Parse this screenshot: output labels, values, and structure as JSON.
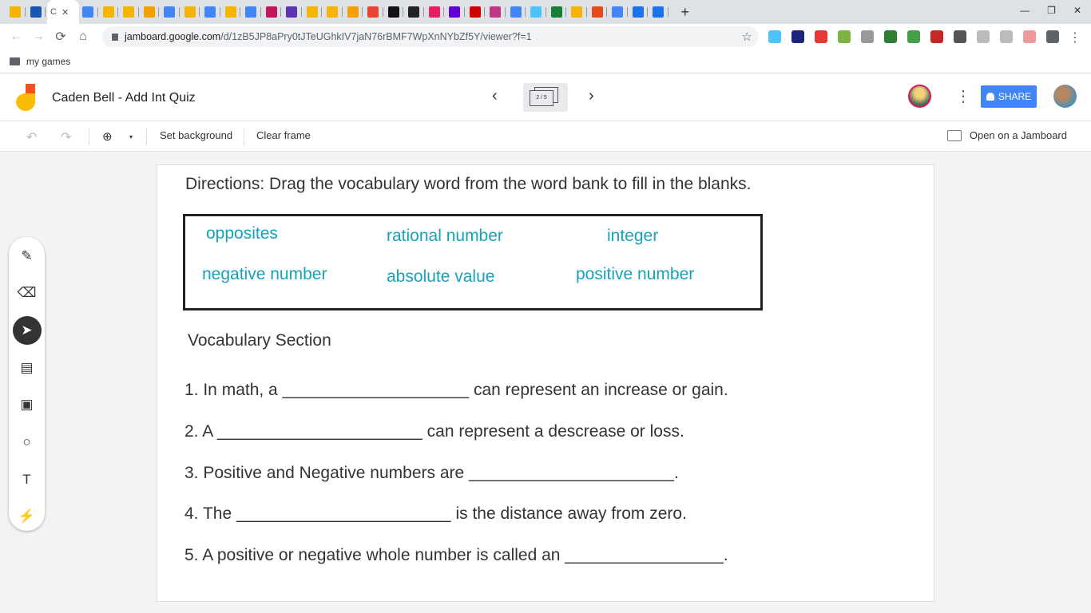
{
  "browser": {
    "active_tab_label": "C",
    "tab_colors": [
      "#f4b400",
      "#1a56b0",
      "#4285f4",
      "#f4b400",
      "#f4b400",
      "#f5a000",
      "#4285f4",
      "#f4b400",
      "#4285f4",
      "#f4b400",
      "#4285f4",
      "#c2185b",
      "#5e35b1",
      "#f4b400",
      "#f4b400",
      "#f5a000",
      "#ea4335",
      "#111111",
      "#222222",
      "#e91e63",
      "#6001d2",
      "#d00000",
      "#c13584",
      "#4285f4",
      "#4fc3f7",
      "#188038",
      "#f4b400",
      "#e64a19",
      "#4285f4",
      "#1a73e8",
      "#1a73e8"
    ],
    "url_host": "jamboard.google.com",
    "url_path": "/d/1zB5JP8aPry0tJTeUGhkIV7jaN76rBMF7WpXnNYbZf5Y/viewer?f=1",
    "extension_colors": [
      "#4fc3f7",
      "#1a237e",
      "#e53935",
      "#7cb342",
      "#999999",
      "#2e7d32",
      "#43a047",
      "#c62828",
      "#555555",
      "#bbbbbb",
      "#bbbbbb",
      "#ef9a9a",
      "#5f6368"
    ],
    "bookmark": "my games"
  },
  "app": {
    "title": "Caden Bell - Add Int Quiz",
    "frame_indicator": "2 / 5",
    "share_label": "SHARE",
    "toolbar": {
      "set_background": "Set background",
      "clear_frame": "Clear frame",
      "open_jamboard": "Open on a Jamboard"
    }
  },
  "frame": {
    "directions": "Directions: Drag the vocabulary word from the word bank to fill in the blanks.",
    "word_bank": [
      "opposites",
      "rational number",
      "integer",
      "negative number",
      "absolute value",
      "positive number"
    ],
    "section_title": "Vocabulary Section",
    "questions": [
      "1. In math, a ____________________ can represent an increase or gain.",
      "2. A ______________________ can represent a descrease or loss.",
      "3. Positive and Negative numbers are ______________________.",
      "4. The _______________________ is the distance away from zero.",
      "5. A positive or negative whole number is called an _________________."
    ]
  },
  "colors": {
    "accent": "#4285f4",
    "word": "#17a2b8"
  }
}
